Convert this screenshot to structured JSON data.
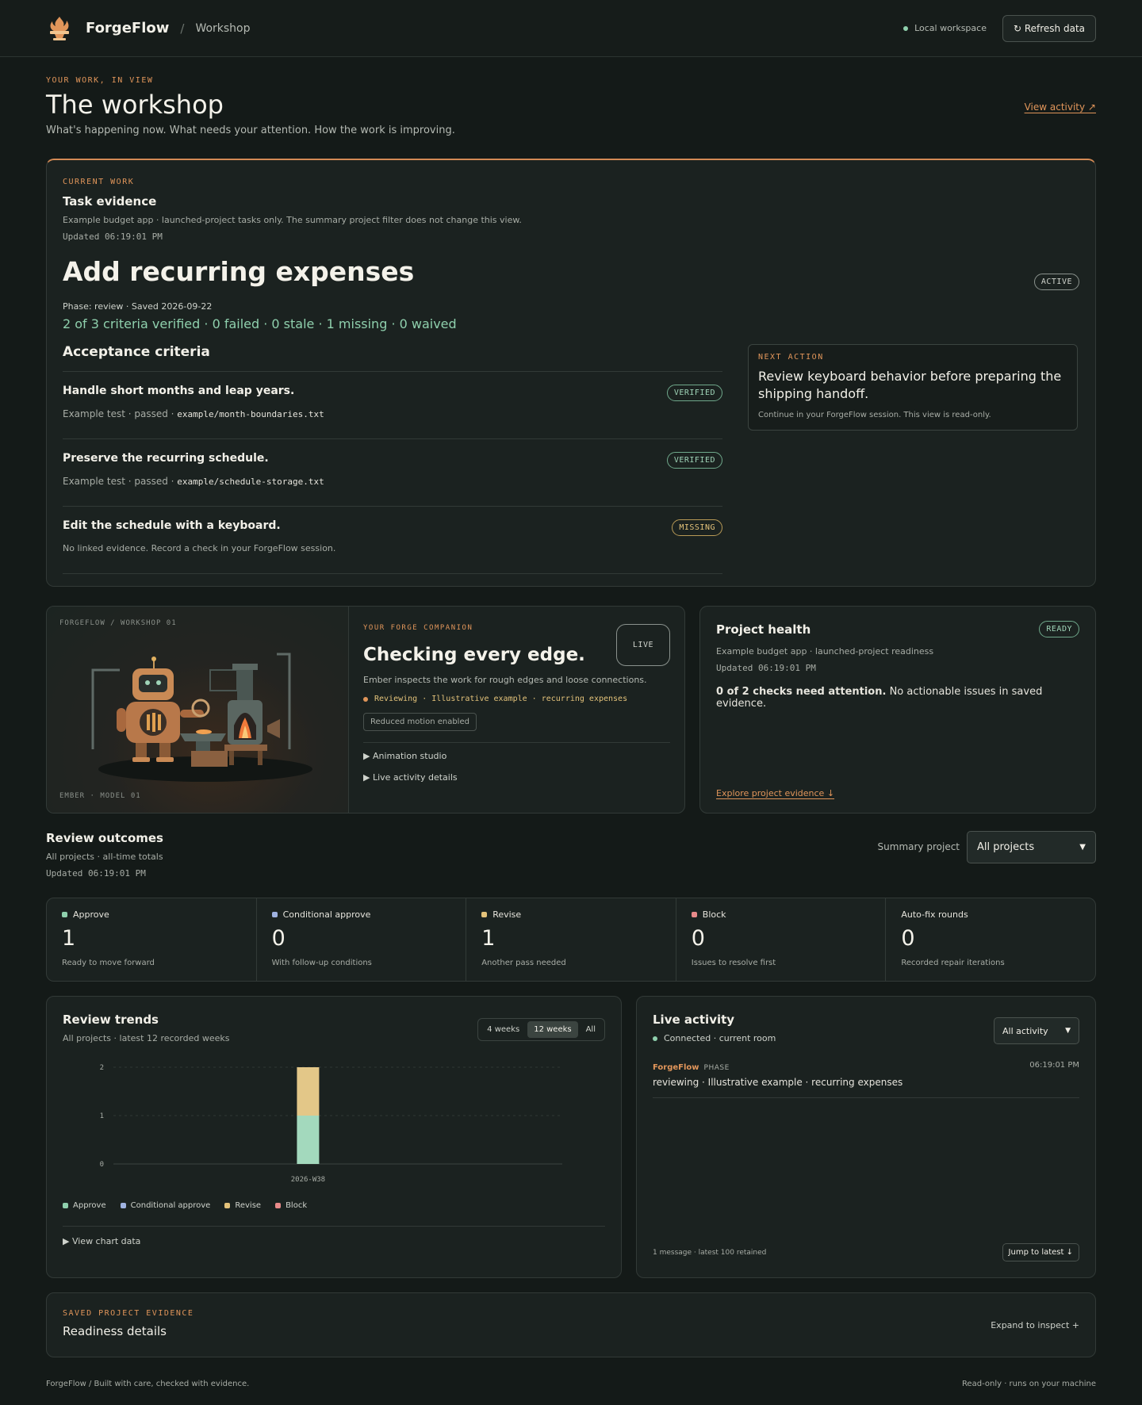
{
  "header": {
    "brand": "ForgeFlow",
    "separator": "/",
    "crumb": "Workshop",
    "workspace": "Local workspace",
    "refresh_label": "↻ Refresh data"
  },
  "hero": {
    "eyebrow": "YOUR WORK, IN VIEW",
    "title": "The workshop",
    "subtitle": "What's happening now. What needs your attention. How the work is improving.",
    "view_activity": "View activity  ↗"
  },
  "current": {
    "eyebrow": "CURRENT WORK",
    "heading": "Task evidence",
    "scope": "Example budget app · launched-project tasks only. The summary project filter does not change this view.",
    "updated": "Updated 06:19:01 PM",
    "task_title": "Add recurring expenses",
    "status_badge": "ACTIVE",
    "phase": "Phase: review · Saved 2026-09-22",
    "criteria_summary": "2 of 3 criteria verified · 0 failed · 0 stale · 1 missing · 0 waived",
    "criteria_heading": "Acceptance criteria",
    "criteria": [
      {
        "name": "Handle short months and leap years.",
        "evidence": "Example test · passed · ",
        "file": "example/month-boundaries.txt",
        "badge": "VERIFIED"
      },
      {
        "name": "Preserve the recurring schedule.",
        "evidence": "Example test · passed · ",
        "file": "example/schedule-storage.txt",
        "badge": "VERIFIED"
      },
      {
        "name": "Edit the schedule with a keyboard.",
        "evidence": "No linked evidence. Record a check in your ForgeFlow session.",
        "file": "",
        "badge": "MISSING"
      }
    ],
    "next_action": {
      "eyebrow": "NEXT ACTION",
      "text": "Review keyboard behavior before preparing the shipping handoff.",
      "note": "Continue in your ForgeFlow session. This view is read-only."
    }
  },
  "companion": {
    "illus_top_label": "FORGEFLOW / WORKSHOP 01",
    "illus_bottom_label": "EMBER · MODEL 01",
    "eyebrow": "YOUR FORGE COMPANION",
    "badge": "LIVE",
    "title": "Checking every edge.",
    "desc": "Ember inspects the work for rough edges and loose connections.",
    "status": "Reviewing · Illustrative example · recurring expenses",
    "chip": "Reduced motion enabled",
    "details": [
      "▶ Animation studio",
      "▶ Live activity details"
    ]
  },
  "health": {
    "title": "Project health",
    "badge": "READY",
    "scope": "Example budget app · launched-project readiness",
    "updated": "Updated 06:19:01 PM",
    "note_bold": "0 of 2 checks need attention.",
    "note_rest": " No actionable issues in saved evidence.",
    "explore": "Explore project evidence  ↓"
  },
  "outcomes": {
    "title": "Review outcomes",
    "scope": "All projects · all-time totals",
    "updated": "Updated 06:19:01 PM",
    "select_label": "Summary project",
    "select_value": "All projects",
    "stats": [
      {
        "label": "Approve",
        "value": "1",
        "hint": "Ready to move forward",
        "color": "#8fd0ad"
      },
      {
        "label": "Conditional approve",
        "value": "0",
        "hint": "With follow-up conditions",
        "color": "#9fb2e0"
      },
      {
        "label": "Revise",
        "value": "1",
        "hint": "Another pass needed",
        "color": "#e3c27a"
      },
      {
        "label": "Block",
        "value": "0",
        "hint": "Issues to resolve first",
        "color": "#e88a8a"
      },
      {
        "label": "Auto-fix rounds",
        "value": "0",
        "hint": "Recorded repair iterations",
        "color": ""
      }
    ]
  },
  "trends": {
    "title": "Review trends",
    "scope": "All projects · latest 12 recorded weeks",
    "ranges": [
      "4 weeks",
      "12 weeks",
      "All"
    ],
    "active_range": "12 weeks",
    "view_data": "▶ View chart data"
  },
  "chart_data": {
    "type": "bar",
    "stacked": true,
    "categories": [
      "2026-W38"
    ],
    "series": [
      {
        "name": "Approve",
        "values": [
          1
        ],
        "color": "#a3d9bd"
      },
      {
        "name": "Conditional approve",
        "values": [
          0
        ],
        "color": "#9fb2e0"
      },
      {
        "name": "Revise",
        "values": [
          1
        ],
        "color": "#e3c788"
      },
      {
        "name": "Block",
        "values": [
          0
        ],
        "color": "#e88a8a"
      }
    ],
    "yticks": [
      0,
      1,
      2
    ],
    "ylim": [
      0,
      2
    ],
    "grid": true,
    "legend": "bottom-left"
  },
  "live": {
    "title": "Live activity",
    "status": "Connected · current room",
    "filter": "All activity",
    "messages": [
      {
        "who": "ForgeFlow",
        "kind": "PHASE",
        "time": "06:19:01 PM",
        "body": "reviewing · Illustrative example · recurring expenses"
      }
    ],
    "footer": "1 message · latest 100 retained",
    "jump": "Jump to latest ↓"
  },
  "saved": {
    "eyebrow": "SAVED PROJECT EVIDENCE",
    "title": "Readiness details",
    "expand": "Expand to inspect   +"
  },
  "footer": {
    "left": "ForgeFlow / Built with care, checked with evidence.",
    "right": "Read-only · runs on your machine"
  },
  "colors": {
    "accent": "#e0955a",
    "ok": "#8fd0ad",
    "connected": "#8fd0ad"
  }
}
